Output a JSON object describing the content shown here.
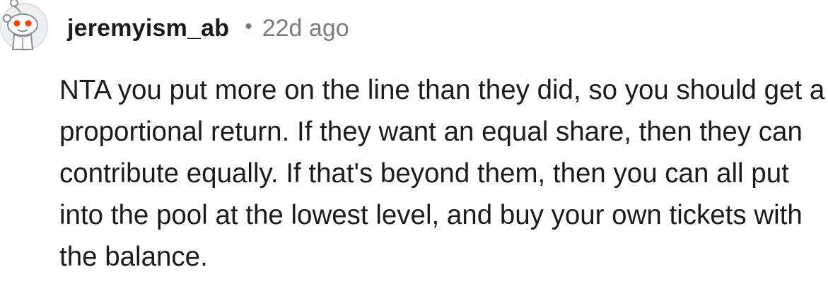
{
  "comment": {
    "avatar_icon": "snoo-avatar-icon",
    "username": "jeremyism_ab",
    "separator": "•",
    "time_ago": "22d ago",
    "body": "NTA you put more on the line than they did, so you should get a proportional return. If they want an equal share, then they can contribute equally. If that's beyond them, then you can all put into the pool at the lowest level, and buy your own tickets with the balance."
  },
  "colors": {
    "text": "#1c1c1c",
    "meta": "#7c7c7c",
    "avatar_eye": "#ff4500"
  }
}
